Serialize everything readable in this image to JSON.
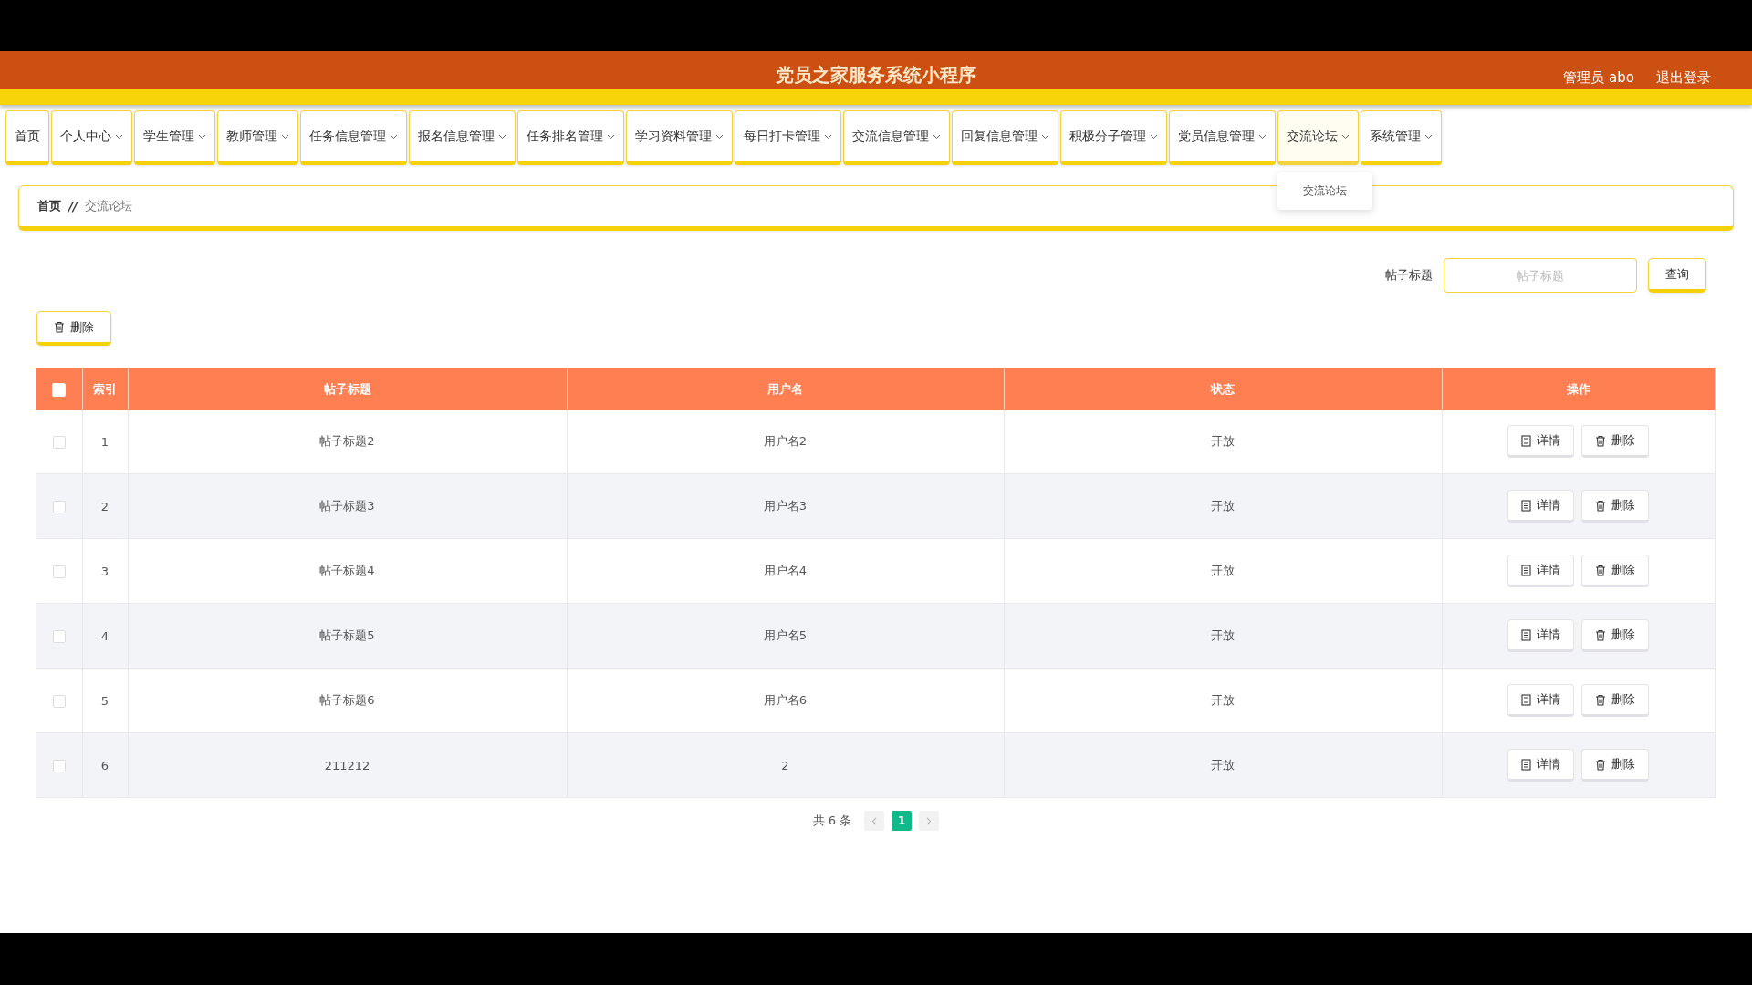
{
  "header": {
    "title": "党员之家服务系统小程序",
    "user": "管理员 abo",
    "logout": "退出登录"
  },
  "nav": [
    {
      "label": "首页",
      "has_menu": false,
      "expanded": false
    },
    {
      "label": "个人中心",
      "has_menu": true,
      "expanded": false
    },
    {
      "label": "学生管理",
      "has_menu": true,
      "expanded": false
    },
    {
      "label": "教师管理",
      "has_menu": true,
      "expanded": false
    },
    {
      "label": "任务信息管理",
      "has_menu": true,
      "expanded": false
    },
    {
      "label": "报名信息管理",
      "has_menu": true,
      "expanded": false
    },
    {
      "label": "任务排名管理",
      "has_menu": true,
      "expanded": false
    },
    {
      "label": "学习资料管理",
      "has_menu": true,
      "expanded": false
    },
    {
      "label": "每日打卡管理",
      "has_menu": true,
      "expanded": false
    },
    {
      "label": "交流信息管理",
      "has_menu": true,
      "expanded": false
    },
    {
      "label": "回复信息管理",
      "has_menu": true,
      "expanded": false
    },
    {
      "label": "积极分子管理",
      "has_menu": true,
      "expanded": false
    },
    {
      "label": "党员信息管理",
      "has_menu": true,
      "expanded": false
    },
    {
      "label": "交流论坛",
      "has_menu": true,
      "expanded": true,
      "submenu": [
        "交流论坛"
      ]
    },
    {
      "label": "系统管理",
      "has_menu": true,
      "expanded": false
    }
  ],
  "breadcrumb": {
    "items": [
      "首页",
      "交流论坛"
    ],
    "separator": "//"
  },
  "search": {
    "label": "帖子标题",
    "placeholder": "帖子标题",
    "button": "查询"
  },
  "bulk_delete": "删除",
  "table": {
    "header_checked": false,
    "columns": [
      "索引",
      "帖子标题",
      "用户名",
      "状态",
      "操作"
    ],
    "rows": [
      {
        "checked": false,
        "index": "1",
        "title": "帖子标题2",
        "user": "用户名2",
        "status": "开放",
        "actions": [
          "详情",
          "删除"
        ]
      },
      {
        "checked": false,
        "index": "2",
        "title": "帖子标题3",
        "user": "用户名3",
        "status": "开放",
        "actions": [
          "详情",
          "删除"
        ]
      },
      {
        "checked": false,
        "index": "3",
        "title": "帖子标题4",
        "user": "用户名4",
        "status": "开放",
        "actions": [
          "详情",
          "删除"
        ]
      },
      {
        "checked": false,
        "index": "4",
        "title": "帖子标题5",
        "user": "用户名5",
        "status": "开放",
        "actions": [
          "详情",
          "删除"
        ]
      },
      {
        "checked": false,
        "index": "5",
        "title": "帖子标题6",
        "user": "用户名6",
        "status": "开放",
        "actions": [
          "详情",
          "删除"
        ]
      },
      {
        "checked": false,
        "index": "6",
        "title": "211212",
        "user": "2",
        "status": "开放",
        "actions": [
          "详情",
          "删除"
        ]
      }
    ]
  },
  "pagination": {
    "total": "共 6 条",
    "pages": [
      {
        "label": "1",
        "selected": true
      }
    ]
  }
}
